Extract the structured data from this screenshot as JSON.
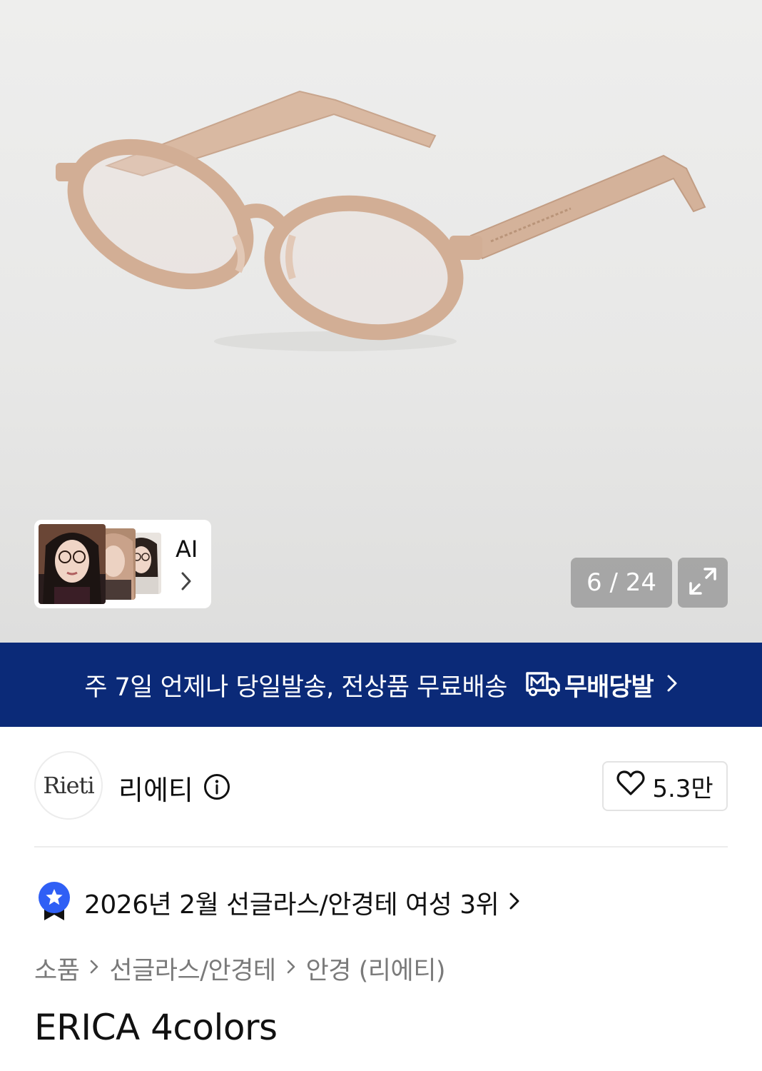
{
  "gallery": {
    "counter": "6 / 24",
    "ai_label": "AI",
    "icons": {
      "expand": "expand-arrows-icon",
      "ai_chevron": "chevron-right-icon"
    }
  },
  "banner": {
    "text": "주 7일 언제나 당일발송, 전상품 무료배송",
    "brand": "무배당발",
    "logo_icon": "delivery-truck-m-icon",
    "color": "#0b2a78"
  },
  "brand": {
    "logo_text": "Rieti",
    "name": "리에티",
    "like_count": "5.3만"
  },
  "ranking": {
    "text": "2026년 2월 선글라스/안경테 여성 3위",
    "badge_color": "#2f5ff5"
  },
  "breadcrumb": [
    "소품",
    "선글라스/안경테",
    "안경 (리에티)"
  ],
  "product": {
    "title": "ERICA 4colors"
  }
}
